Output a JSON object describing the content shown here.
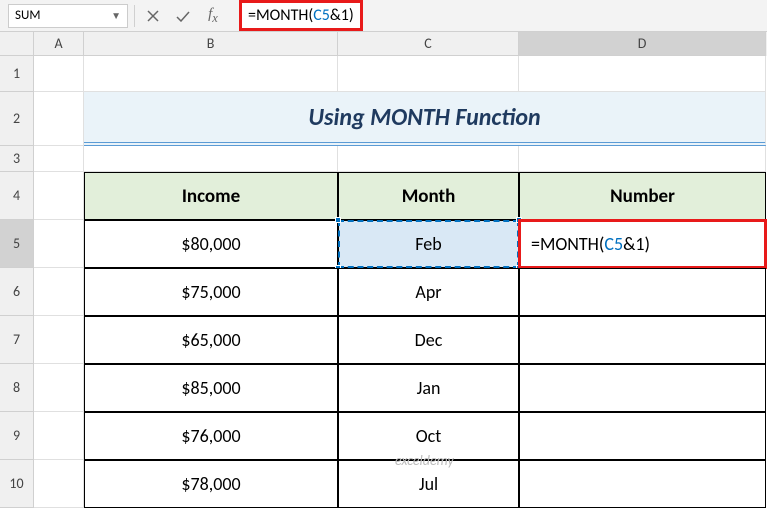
{
  "nameBox": "SUM",
  "formula": {
    "prefix": "=MONTH(",
    "ref": "C5",
    "suffix": "&1)"
  },
  "columns": {
    "A": "A",
    "B": "B",
    "C": "C",
    "D": "D"
  },
  "rows": [
    "1",
    "2",
    "3",
    "4",
    "5",
    "6",
    "7",
    "8",
    "9",
    "10"
  ],
  "title": "Using MONTH Function",
  "headers": {
    "income": "Income",
    "month": "Month",
    "number": "Number"
  },
  "data": [
    {
      "income": "$80,000",
      "month": "Feb"
    },
    {
      "income": "$75,000",
      "month": "Apr"
    },
    {
      "income": "$65,000",
      "month": "Dec"
    },
    {
      "income": "$85,000",
      "month": "Jan"
    },
    {
      "income": "$76,000",
      "month": "Oct"
    },
    {
      "income": "$78,000",
      "month": "Jul"
    }
  ],
  "editCell": {
    "prefix": "=MONTH(",
    "ref": "C5",
    "suffix": "&1)"
  },
  "watermark": "exceldemy"
}
